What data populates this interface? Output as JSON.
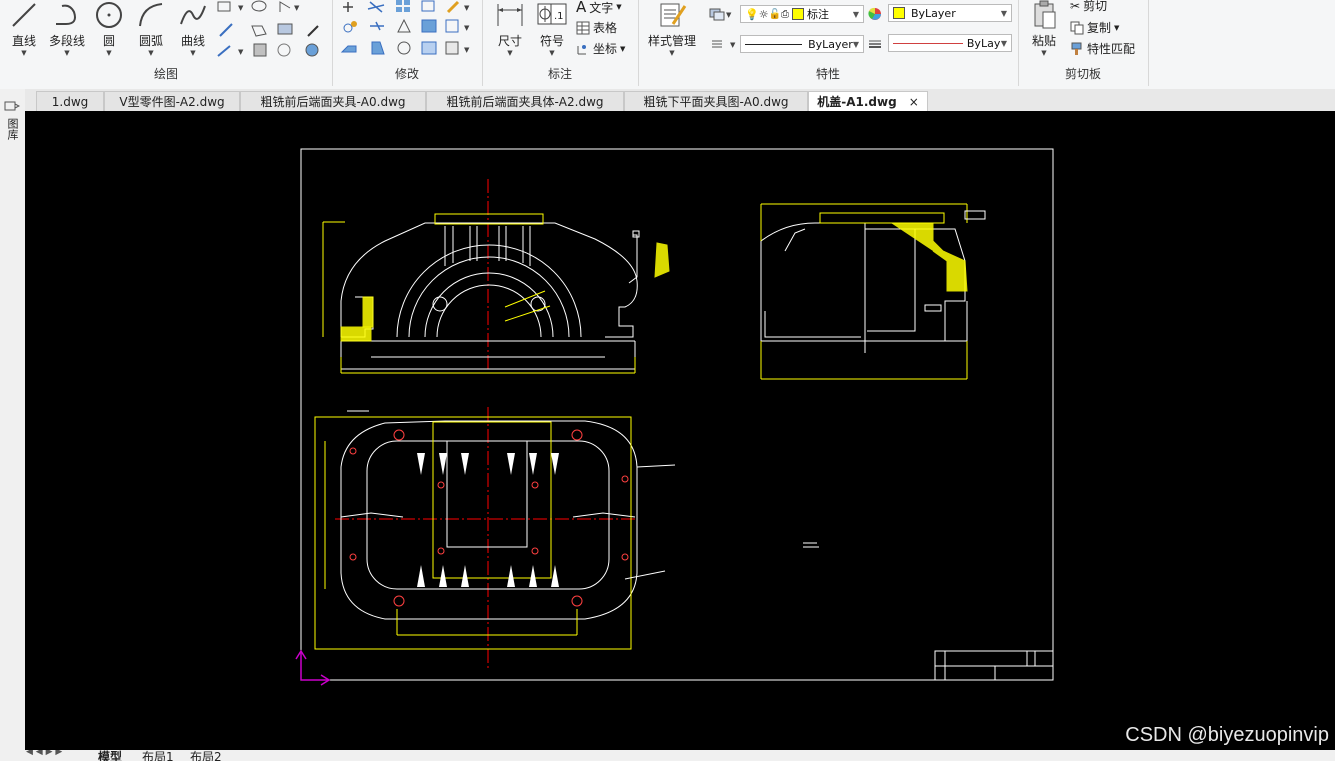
{
  "ribbon": {
    "draw": {
      "group_label": "绘图",
      "line": "直线",
      "polyline": "多段线",
      "circle": "圆",
      "arc": "圆弧",
      "curve": "曲线"
    },
    "modify": {
      "group_label": "修改"
    },
    "annotate": {
      "group_label": "标注",
      "dimension": "尺寸",
      "symbol": "符号",
      "text": "文字",
      "table": "表格",
      "coordinate": "坐标"
    },
    "properties": {
      "group_label": "特性",
      "style_manager": "样式管理",
      "layer_value": "标注",
      "color_value": "ByLayer",
      "linetype_value": "ByLayer",
      "lineweight_value": "ByLayer"
    },
    "clipboard": {
      "group_label": "剪切板",
      "paste": "粘贴",
      "cut": "剪切",
      "copy": "复制",
      "match_properties": "特性匹配"
    }
  },
  "tabs": [
    {
      "label": "1.dwg"
    },
    {
      "label": "V型零件图-A2.dwg"
    },
    {
      "label": "粗铣前后端面夹具-A0.dwg"
    },
    {
      "label": "粗铣前后端面夹具体-A2.dwg"
    },
    {
      "label": "粗铣下平面夹具图-A0.dwg"
    },
    {
      "label": "机盖-A1.dwg",
      "close": "×"
    }
  ],
  "side_panel": {
    "label": "图库"
  },
  "layouts": {
    "model": "模型",
    "layout1": "布局1",
    "layout2": "布局2"
  },
  "watermark": "CSDN @biyezuopinvip",
  "colors": {
    "canvas": "#000000",
    "cad_white": "#ffffff",
    "cad_yellow": "#ffff00",
    "cad_red": "#ff0000",
    "ucs": "#cc00cc"
  }
}
